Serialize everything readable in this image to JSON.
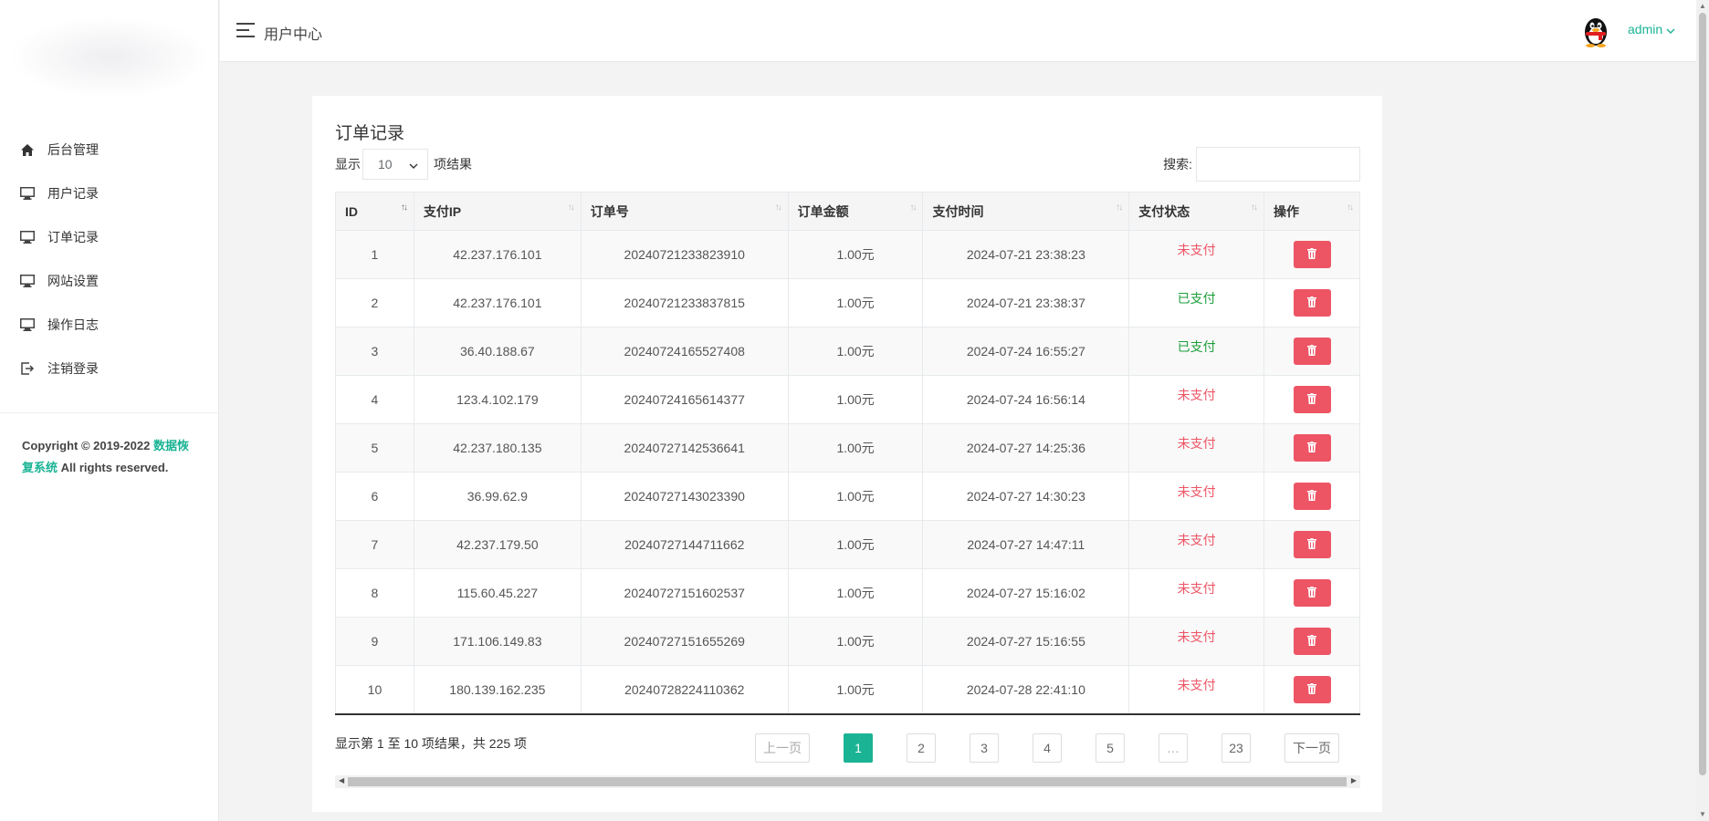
{
  "topbar": {
    "title": "用户中心",
    "user": "admin"
  },
  "sidebar": {
    "items": [
      {
        "label": "后台管理",
        "icon": "home-icon"
      },
      {
        "label": "用户记录",
        "icon": "monitor-icon"
      },
      {
        "label": "订单记录",
        "icon": "monitor-icon"
      },
      {
        "label": "网站设置",
        "icon": "monitor-icon"
      },
      {
        "label": "操作日志",
        "icon": "monitor-icon"
      },
      {
        "label": "注销登录",
        "icon": "logout-icon"
      }
    ],
    "copyright": {
      "prefix": "Copyright © 2019-2022 ",
      "link": "数据恢复系统",
      "suffix": " All rights reserved."
    }
  },
  "card": {
    "title": "订单记录",
    "length": {
      "prefix": "显示",
      "value": "10",
      "suffix": "项结果"
    },
    "search_label": "搜索:"
  },
  "table": {
    "columns": [
      "ID",
      "支付IP",
      "订单号",
      "订单金额",
      "支付时间",
      "支付状态",
      "操作"
    ],
    "rows": [
      {
        "id": "1",
        "ip": "42.237.176.101",
        "order": "20240721233823910",
        "amount": "1.00元",
        "time": "2024-07-21 23:38:23",
        "status": "未支付",
        "paid": false
      },
      {
        "id": "2",
        "ip": "42.237.176.101",
        "order": "20240721233837815",
        "amount": "1.00元",
        "time": "2024-07-21 23:38:37",
        "status": "已支付",
        "paid": true
      },
      {
        "id": "3",
        "ip": "36.40.188.67",
        "order": "20240724165527408",
        "amount": "1.00元",
        "time": "2024-07-24 16:55:27",
        "status": "已支付",
        "paid": true
      },
      {
        "id": "4",
        "ip": "123.4.102.179",
        "order": "20240724165614377",
        "amount": "1.00元",
        "time": "2024-07-24 16:56:14",
        "status": "未支付",
        "paid": false
      },
      {
        "id": "5",
        "ip": "42.237.180.135",
        "order": "20240727142536641",
        "amount": "1.00元",
        "time": "2024-07-27 14:25:36",
        "status": "未支付",
        "paid": false
      },
      {
        "id": "6",
        "ip": "36.99.62.9",
        "order": "20240727143023390",
        "amount": "1.00元",
        "time": "2024-07-27 14:30:23",
        "status": "未支付",
        "paid": false
      },
      {
        "id": "7",
        "ip": "42.237.179.50",
        "order": "20240727144711662",
        "amount": "1.00元",
        "time": "2024-07-27 14:47:11",
        "status": "未支付",
        "paid": false
      },
      {
        "id": "8",
        "ip": "115.60.45.227",
        "order": "20240727151602537",
        "amount": "1.00元",
        "time": "2024-07-27 15:16:02",
        "status": "未支付",
        "paid": false
      },
      {
        "id": "9",
        "ip": "171.106.149.83",
        "order": "20240727151655269",
        "amount": "1.00元",
        "time": "2024-07-27 15:16:55",
        "status": "未支付",
        "paid": false
      },
      {
        "id": "10",
        "ip": "180.139.162.235",
        "order": "20240728224110362",
        "amount": "1.00元",
        "time": "2024-07-28 22:41:10",
        "status": "未支付",
        "paid": false
      }
    ]
  },
  "footer": {
    "info": "显示第 1 至 10 项结果，共 225 项",
    "pagination": [
      "上一页",
      "1",
      "2",
      "3",
      "4",
      "5",
      "…",
      "23",
      "下一页"
    ]
  },
  "colors": {
    "accent": "#1ab394",
    "danger": "#ed5565",
    "paid": "#1c9e3a"
  }
}
